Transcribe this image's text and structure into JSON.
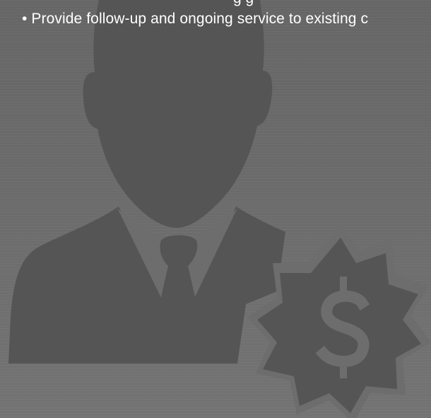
{
  "content": {
    "cut_off_text": "g     g",
    "bullet_text": "• Provide follow-up and ongoing service to existing c"
  },
  "graphic": {
    "subject": "businessman-with-dollar-badge",
    "badge_symbol": "$",
    "colors": {
      "background": "#6b6b6b",
      "silhouette": "#555555",
      "shirt": "#6d6d6d",
      "tie": "#555555",
      "badge_ring": "#6d6d6d",
      "badge": "#555555",
      "text": "#ffffff"
    }
  }
}
